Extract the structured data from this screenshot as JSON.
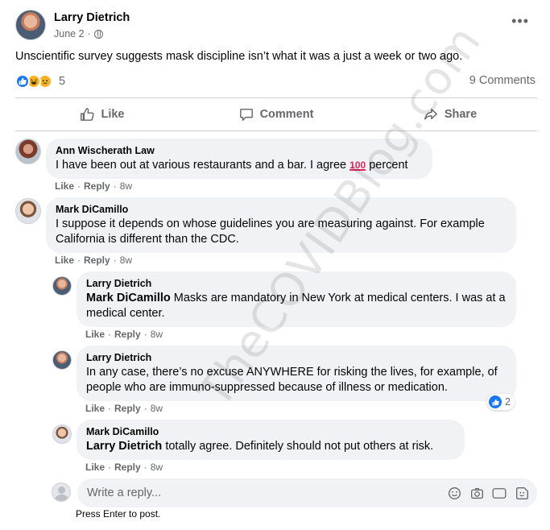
{
  "post": {
    "author": "Larry Dietrich",
    "date": "June 2",
    "date_separator": "·",
    "text": "Unscientific survey suggests mask discipline isn’t what it was a just a week or two ago.",
    "reaction_count": "5",
    "comment_count": "9 Comments",
    "more_label": "•••"
  },
  "actions": {
    "like": "Like",
    "comment": "Comment",
    "share": "Share"
  },
  "comments": [
    {
      "author": "Ann Wischerath Law",
      "text_before": "I have been out at various restaurants and a bar. I agree ",
      "emoji": "100",
      "text_after": " percent",
      "like": "Like",
      "reply": "Reply",
      "sep": "·",
      "time": "8w"
    },
    {
      "author": "Mark DiCamillo",
      "text": "I suppose it depends on whose guidelines you are measuring against. For example California is different than the CDC.",
      "like": "Like",
      "reply": "Reply",
      "sep": "·",
      "time": "8w"
    }
  ],
  "replies": [
    {
      "author": "Larry Dietrich",
      "tag": "Mark DiCamillo",
      "text": " Masks are mandatory in New York at medical centers. I was at a medical center.",
      "like": "Like",
      "reply": "Reply",
      "sep": "·",
      "time": "8w"
    },
    {
      "author": "Larry Dietrich",
      "text": "In any case, there’s no excuse ANYWHERE for risking the lives, for example, of people who are immuno-suppressed because of illness or medication.",
      "like": "Like",
      "reply": "Reply",
      "sep": "·",
      "time": "8w",
      "reactions": "2"
    },
    {
      "author": "Mark DiCamillo",
      "tag": "Larry Dietrich",
      "text": " totally agree. Definitely should not put others at risk.",
      "like": "Like",
      "reply": "Reply",
      "sep": "·",
      "time": "8w"
    }
  ],
  "reply_box": {
    "placeholder": "Write a reply...",
    "hint": "Press Enter to post.",
    "gif_label": "GIF"
  },
  "watermark": "TheCOVIDBlog.com",
  "colors": {
    "accent": "#1877f2",
    "muted": "#65676b",
    "bubble": "#f0f2f5",
    "divider": "#ced0d4"
  }
}
